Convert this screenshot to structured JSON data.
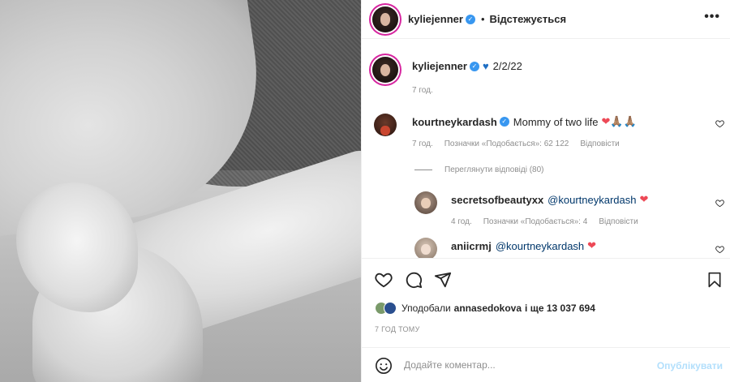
{
  "header": {
    "username": "kyliejenner",
    "separator": "•",
    "follow_status": "Відстежується",
    "more": "•••"
  },
  "caption": {
    "username": "kyliejenner",
    "text": "2/2/22",
    "time": "7 год."
  },
  "comments": [
    {
      "username": "kourtneykardash",
      "text": "Mommy of two life",
      "emoji": "❤🙏🏽🙏🏽",
      "time": "7 год.",
      "likes": "Позначки «Подобається»: 62 122",
      "reply": "Відповісти"
    }
  ],
  "view_replies": "Переглянути відповіді (80)",
  "replies": [
    {
      "username": "secretsofbeautyxx",
      "text": "@kourtneykardash",
      "emoji": "❤",
      "time": "4 год.",
      "likes": "Позначки «Подобається»: 4",
      "reply": "Відповісти"
    },
    {
      "username": "aniicrmj",
      "text": "@kourtneykardash",
      "emoji": "❤"
    }
  ],
  "likes_line": {
    "prefix": "Уподобали",
    "user": "annasedokova",
    "suffix": "і ще 13 037 694"
  },
  "time_ago": "7 ГОД ТОМУ",
  "add_comment": {
    "placeholder": "Додайте коментар...",
    "publish": "Опублікувати"
  },
  "icons": {
    "heart": "heart-icon",
    "comment": "comment-icon",
    "share": "share-icon",
    "save": "bookmark-icon",
    "emoji": "emoji-icon"
  },
  "colors": {
    "verified": "#3897f0",
    "red_heart": "#ed4956",
    "blue_heart": "#1f6fc4",
    "publish": "#b2dffc"
  }
}
